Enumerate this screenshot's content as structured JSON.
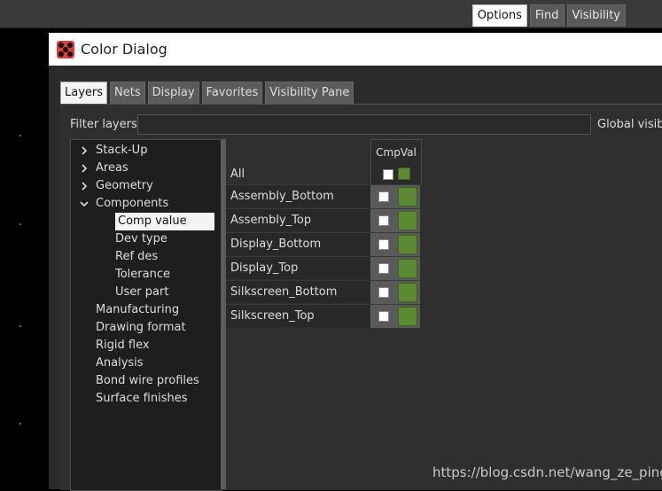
{
  "top_tabs": [
    "Options",
    "Find",
    "Visibility"
  ],
  "dialog": {
    "title": "Color Dialog",
    "tabs": [
      "Layers",
      "Nets",
      "Display",
      "Favorites",
      "Visibility Pane"
    ],
    "filter_label": "Filter layers:",
    "filter_value": "",
    "global_label": "Global visibili",
    "tree": [
      {
        "label": "Stack-Up",
        "indent": 0,
        "expander": "chevron-right-icon"
      },
      {
        "label": "Areas",
        "indent": 0,
        "expander": "chevron-right-icon"
      },
      {
        "label": "Geometry",
        "indent": 0,
        "expander": "chevron-right-icon"
      },
      {
        "label": "Components",
        "indent": 0,
        "expander": "chevron-down-icon"
      },
      {
        "label": "Comp value",
        "indent": 1,
        "selected": true
      },
      {
        "label": "Dev type",
        "indent": 1
      },
      {
        "label": "Ref des",
        "indent": 1
      },
      {
        "label": "Tolerance",
        "indent": 1
      },
      {
        "label": "User part",
        "indent": 1
      },
      {
        "label": "Manufacturing",
        "indent": 0
      },
      {
        "label": "Drawing format",
        "indent": 0
      },
      {
        "label": "Rigid flex",
        "indent": 0
      },
      {
        "label": "Analysis",
        "indent": 0
      },
      {
        "label": "Bond wire profiles",
        "indent": 0
      },
      {
        "label": "Surface finishes",
        "indent": 0
      }
    ],
    "grid": {
      "column_header": "CmpVal",
      "all_label": "All",
      "rows": [
        "Assembly_Bottom",
        "Assembly_Top",
        "Display_Bottom",
        "Display_Top",
        "Silkscreen_Bottom",
        "Silkscreen_Top"
      ],
      "swatch_color": "#5b8a32"
    }
  },
  "watermark": "https://blog.csdn.net/wang_ze_ping"
}
